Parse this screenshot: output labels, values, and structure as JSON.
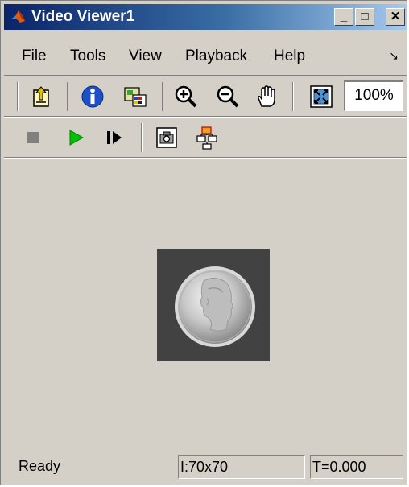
{
  "window": {
    "title": "Video Viewer1",
    "caption_buttons": {
      "minimize": "_",
      "maximize": "□",
      "close": "✕"
    }
  },
  "menu": {
    "items": [
      "File",
      "Tools",
      "View",
      "Playback",
      "Help"
    ],
    "overflow_arrow": "↘"
  },
  "toolbar1": {
    "icons": [
      "open-file-icon",
      "info-icon",
      "colormap-icon",
      "zoom-in-icon",
      "zoom-out-icon",
      "pan-hand-icon",
      "fit-to-window-icon"
    ],
    "zoom_value": "100%"
  },
  "toolbar2": {
    "icons": [
      "stop-icon",
      "play-icon",
      "step-forward-icon",
      "snapshot-icon",
      "highlight-simulink-block-icon"
    ]
  },
  "display": {
    "image_description": "dime coin"
  },
  "status": {
    "state": "Ready",
    "image_size": "I:70x70",
    "time": "T=0.000"
  },
  "colors": {
    "title_gradient_start": "#0a246a",
    "title_gradient_end": "#a6caf0",
    "chrome_bg": "#d4d0c8",
    "play_green": "#00c000",
    "frame_bg": "#424242"
  }
}
